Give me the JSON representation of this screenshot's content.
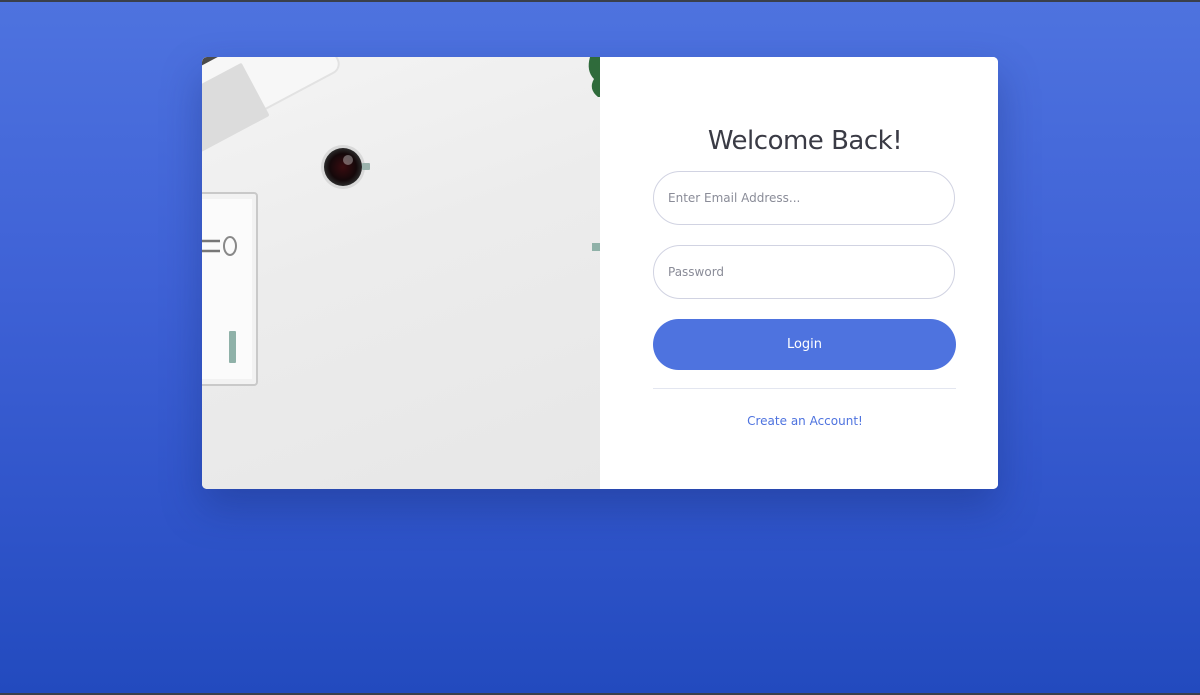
{
  "login": {
    "title": "Welcome Back!",
    "email_placeholder": "Enter Email Address...",
    "password_placeholder": "Password",
    "login_label": "Login",
    "create_account_label": "Create an Account!"
  },
  "colors": {
    "background_top": "#4e73df",
    "background_bottom": "#224abe",
    "primary": "#4e73df",
    "title_text": "#3a3b45"
  },
  "image": {
    "description_icons": [
      "laptop-icon",
      "coffee-cup-icon",
      "clipboard-icon",
      "plant-icon"
    ]
  }
}
